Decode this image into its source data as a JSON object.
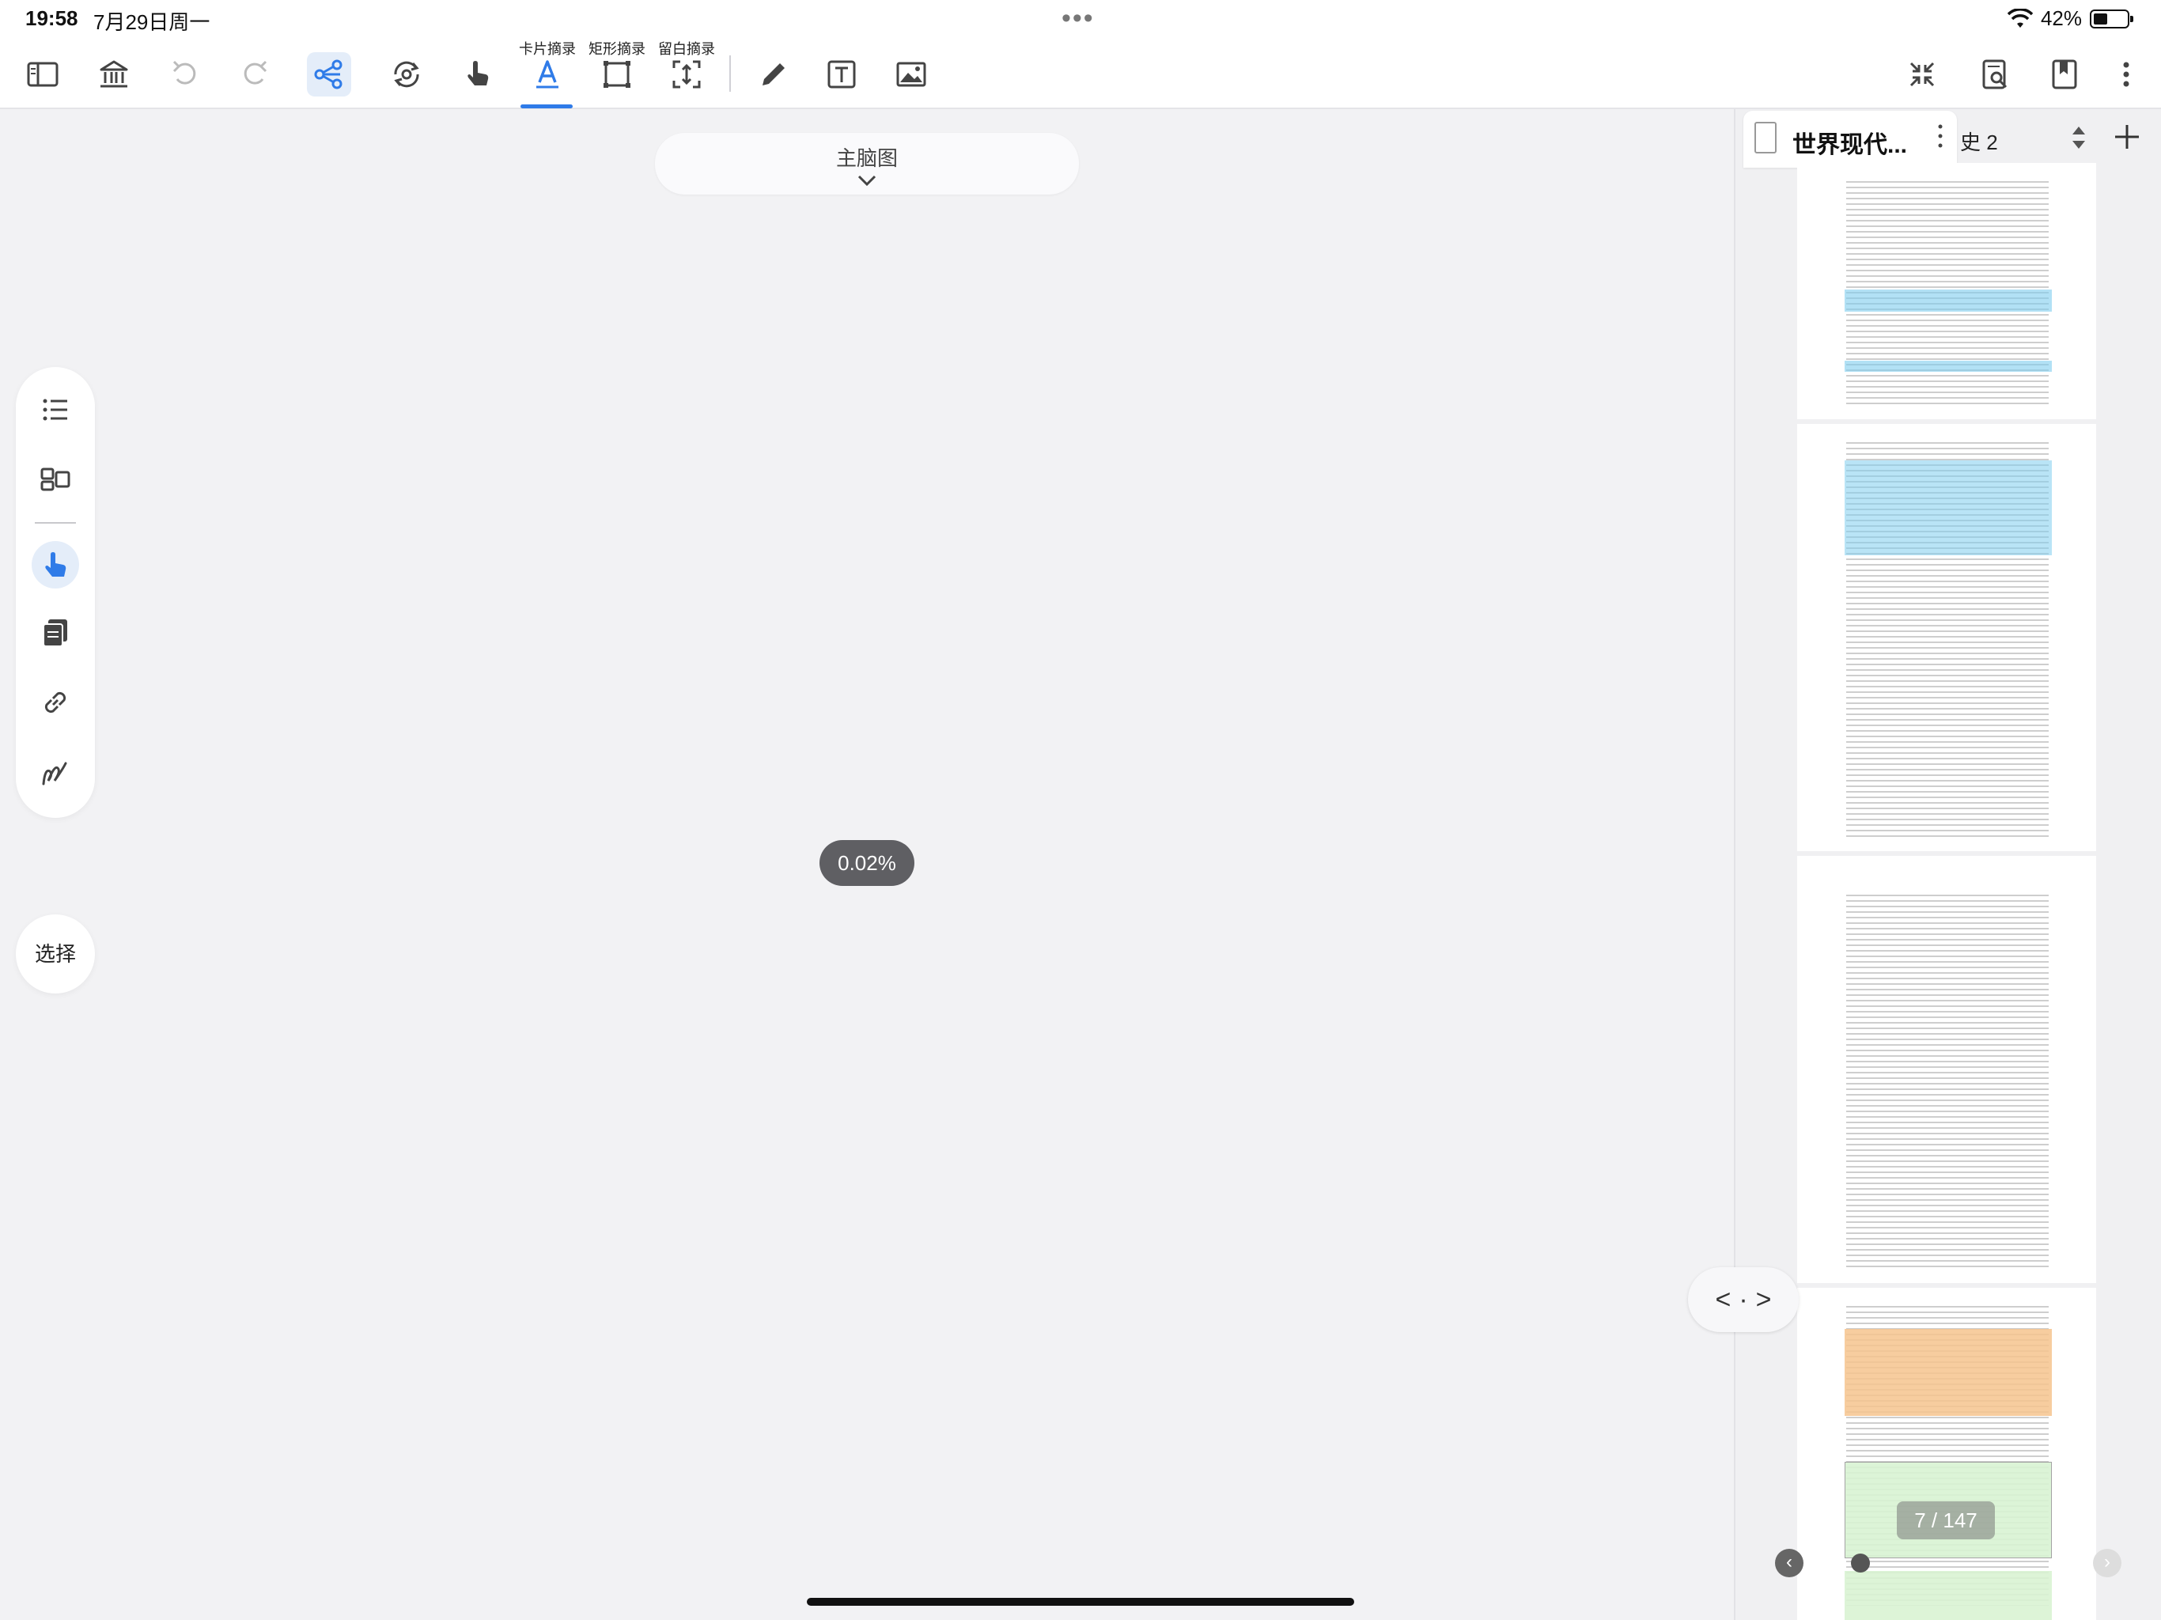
{
  "status": {
    "time": "19:58",
    "date": "7月29日周一",
    "battery": "42%"
  },
  "toolbar": {
    "labels": {
      "card": "卡片摘录",
      "rect": "矩形摘录",
      "blank": "留白摘录"
    }
  },
  "mindmap": {
    "title": "主脑图",
    "zoom": "0.02%"
  },
  "sidepanel": {
    "select_label": "选择"
  },
  "document": {
    "tab_title": "世界现代...",
    "tab2_label": "史 2",
    "page_indicator": "7 / 147"
  },
  "colors": {
    "accent": "#2f7be8",
    "highlight_blue": "#7fcdee",
    "highlight_orange": "#f6c48e",
    "highlight_green": "#d9f3d3"
  }
}
